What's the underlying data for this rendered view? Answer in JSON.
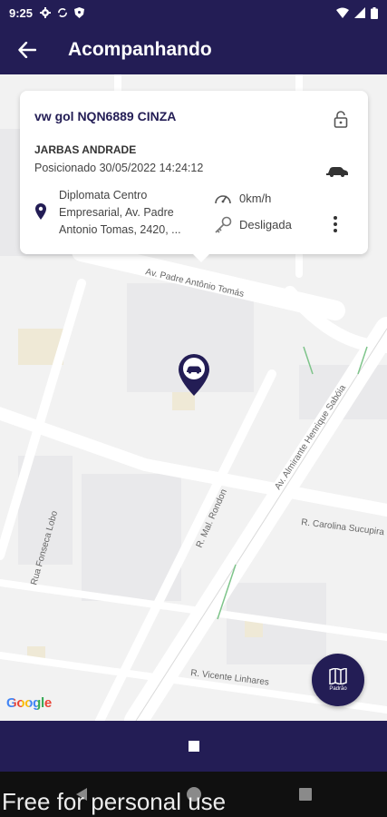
{
  "status_bar": {
    "time": "9:25"
  },
  "app_bar": {
    "title": "Acompanhando"
  },
  "vehicle_card": {
    "vehicle": "vw gol NQN6889 CINZA",
    "driver": "JARBAS ANDRADE",
    "position": "Posicionado 30/05/2022 14:24:12",
    "address": "Diplomata Centro Empresarial, Av. Padre Antonio Tomas, 2420, ...",
    "speed": "0km/h",
    "ignition": "Desligada"
  },
  "map": {
    "streets": {
      "padre": "Av. Padre Antônio Tomás",
      "henrique": "Av. Almirante Henrique Sabóia",
      "rondon": "R. Mal. Rondon",
      "fonseca": "Rua Fonseca Lobo",
      "carolina": "R. Carolina Sucupira",
      "vicente": "R. Vicente Linhares"
    },
    "attribution": "Google"
  },
  "fab": {
    "label": "Padrão"
  },
  "watermark": "Free for personal use",
  "colors": {
    "primary": "#231d55",
    "map_bg": "#f2f2f2",
    "road": "#ffffff"
  },
  "icons": [
    "back-arrow-icon",
    "lock-open-icon",
    "car-icon",
    "location-pin-icon",
    "speedometer-icon",
    "key-icon",
    "more-vertical-icon",
    "map-layers-icon"
  ]
}
